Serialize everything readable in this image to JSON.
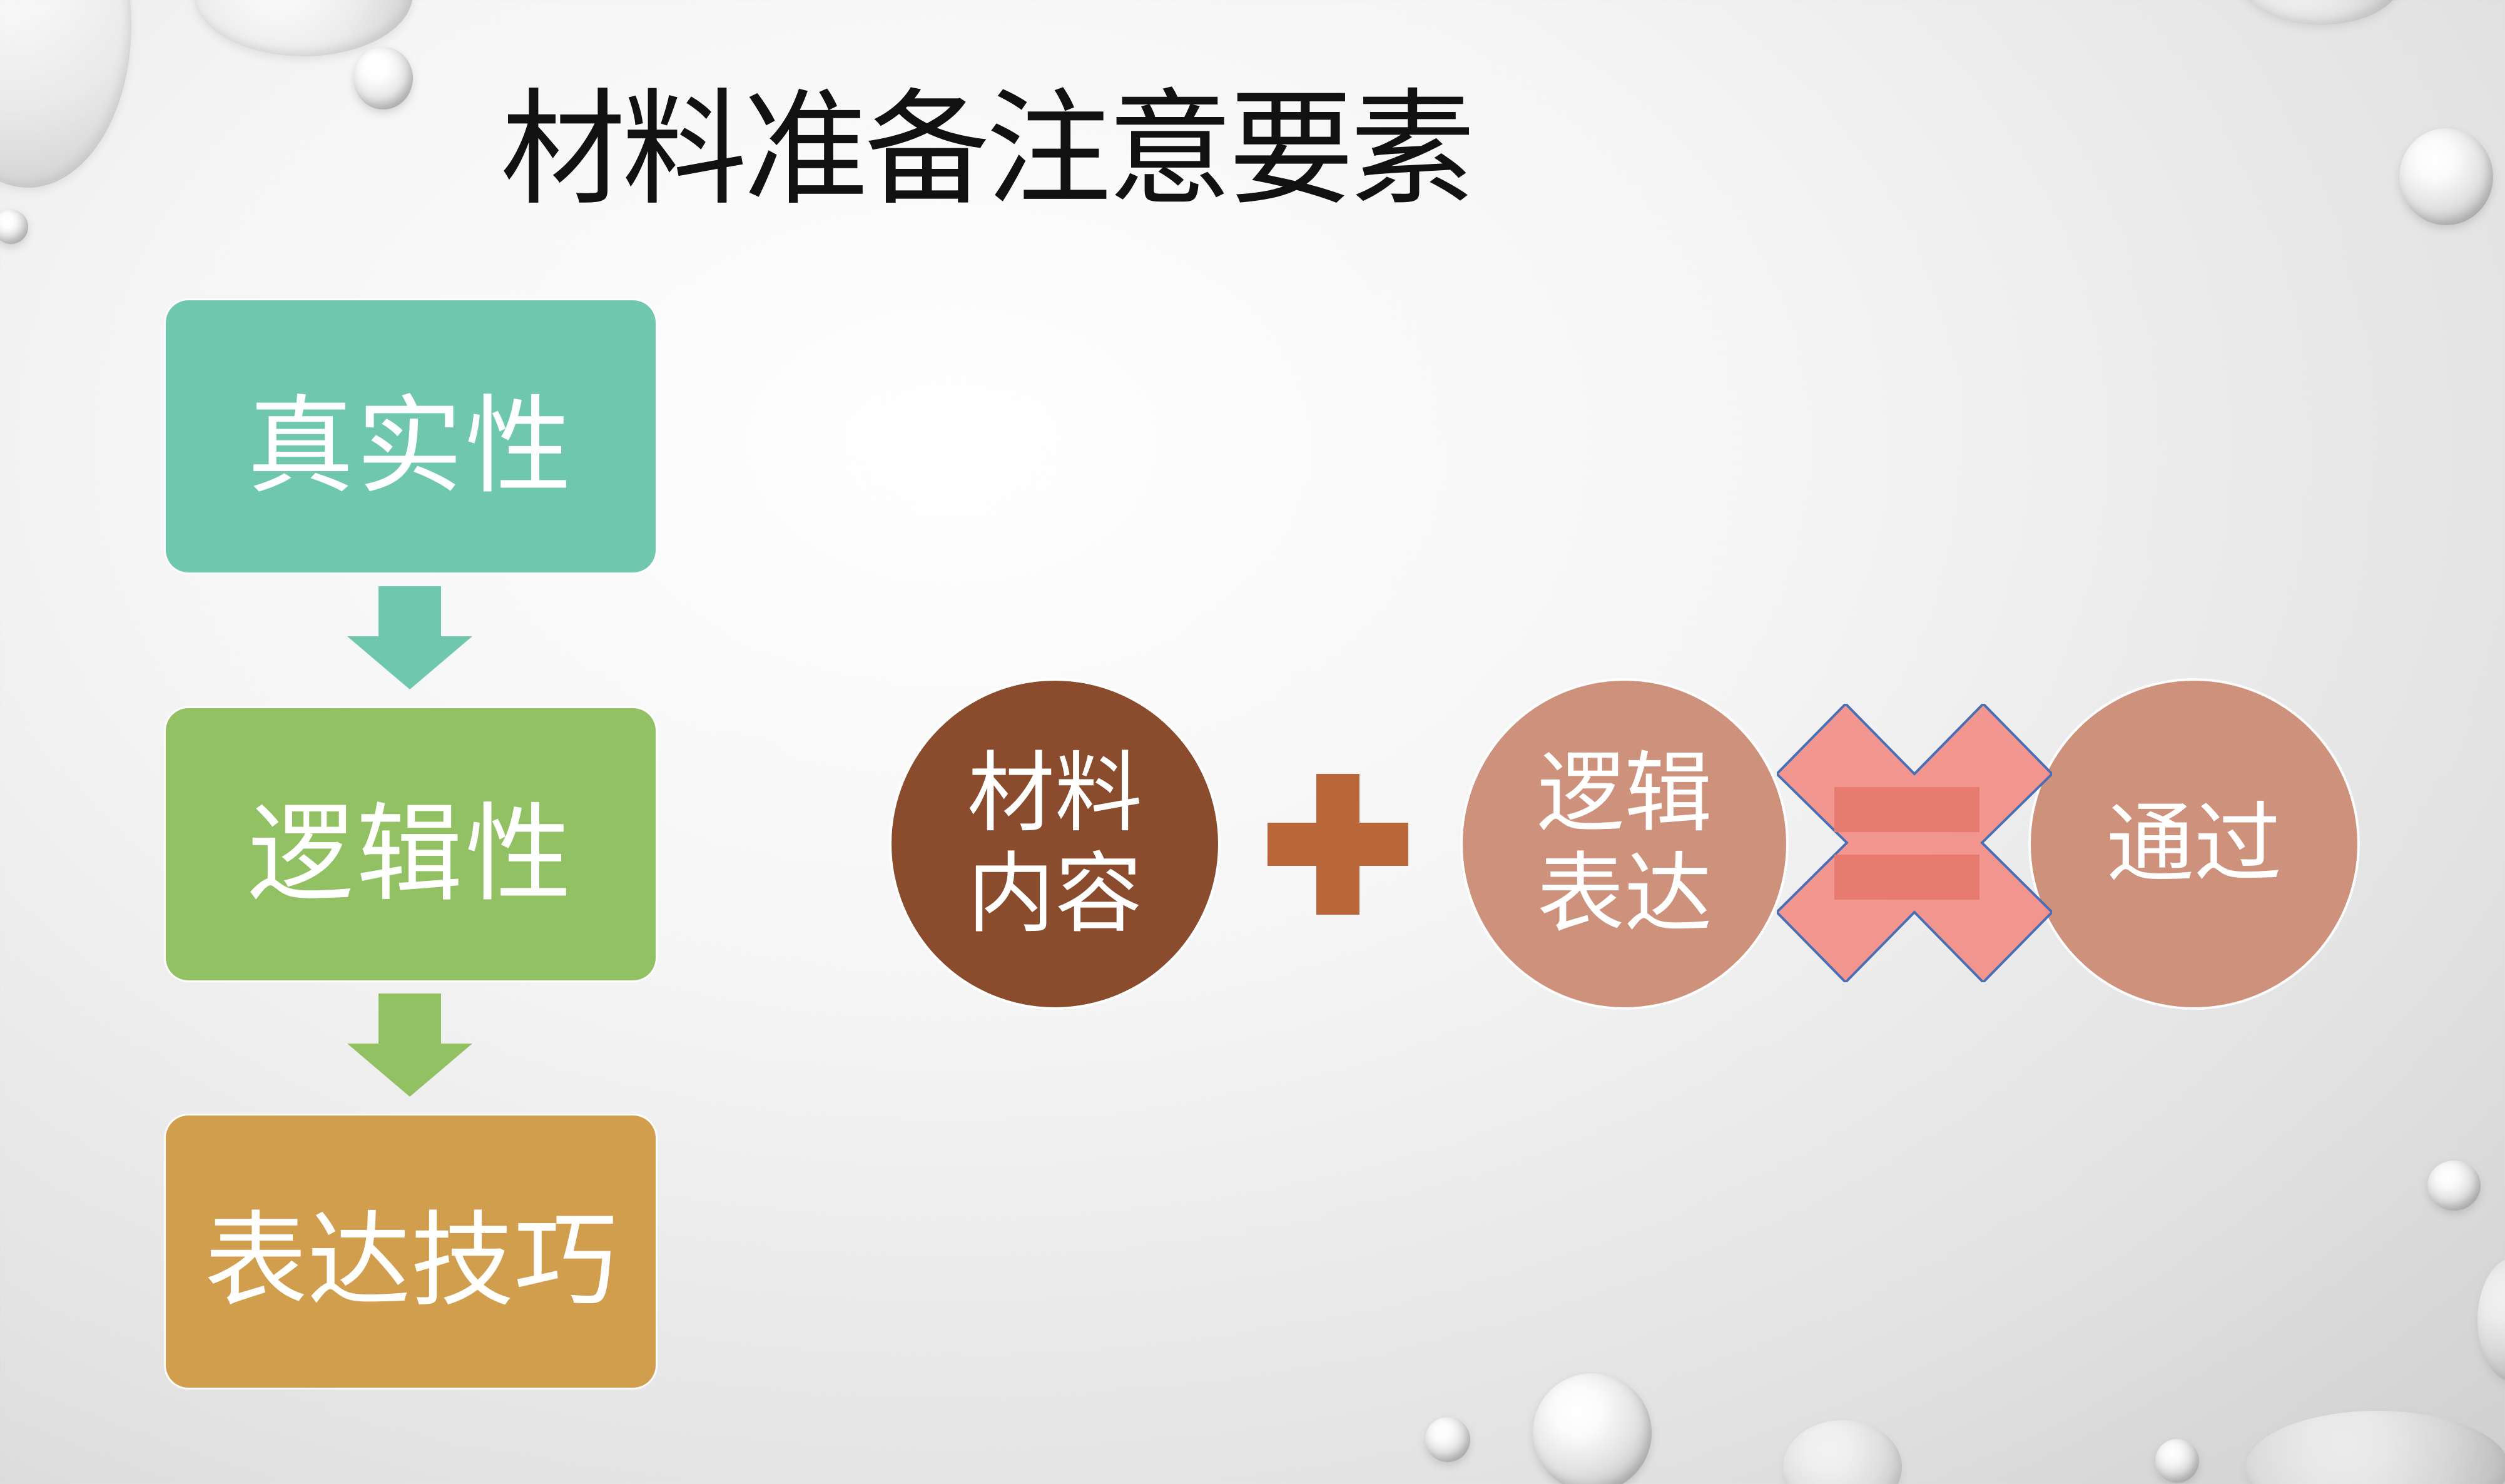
{
  "title": "材料准备注意要素",
  "flow": {
    "items": [
      {
        "label": "真实性",
        "color": "#6fc8ad"
      },
      {
        "label": "逻辑性",
        "color": "#92c163"
      },
      {
        "label": "表达技巧",
        "color": "#d19e4d"
      }
    ]
  },
  "equation": {
    "content_label": "材料内容",
    "logic_label": "逻辑表达",
    "result_label": "通过",
    "content_color": "#8b4c2d",
    "logic_color": "#cd917c",
    "result_color": "#cd917c",
    "plus_color": "#b8663a",
    "x_color": "#f2908a",
    "equals_color": "#e77b70"
  },
  "decor": {
    "droplet_icon": "water-droplet-icon"
  }
}
